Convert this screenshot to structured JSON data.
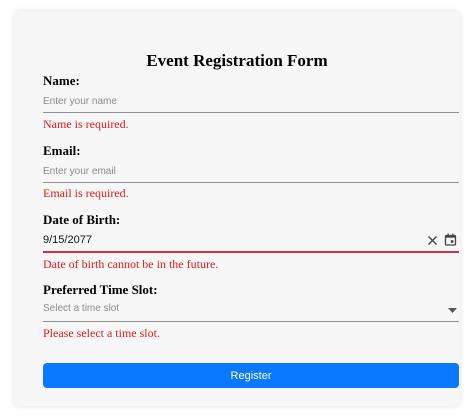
{
  "form": {
    "title": "Event Registration Form",
    "name": {
      "label": "Name:",
      "placeholder": "Enter your name",
      "value": "",
      "error": "Name is required."
    },
    "email": {
      "label": "Email:",
      "placeholder": "Enter your email",
      "value": "",
      "error": "Email is required."
    },
    "dob": {
      "label": "Date of Birth:",
      "value": "9/15/2077",
      "error": "Date of birth cannot be in the future."
    },
    "time_slot": {
      "label": "Preferred Time Slot:",
      "placeholder": "Select a time slot",
      "error": "Please select a time slot."
    },
    "submit_label": "Register"
  },
  "icons": {
    "clear": "close-icon",
    "calendar": "calendar-icon",
    "dropdown": "caret-down-icon"
  },
  "colors": {
    "error_text": "#e01a1a",
    "invalid_underline": "#d32f4a",
    "primary_button": "#0b79ff"
  }
}
